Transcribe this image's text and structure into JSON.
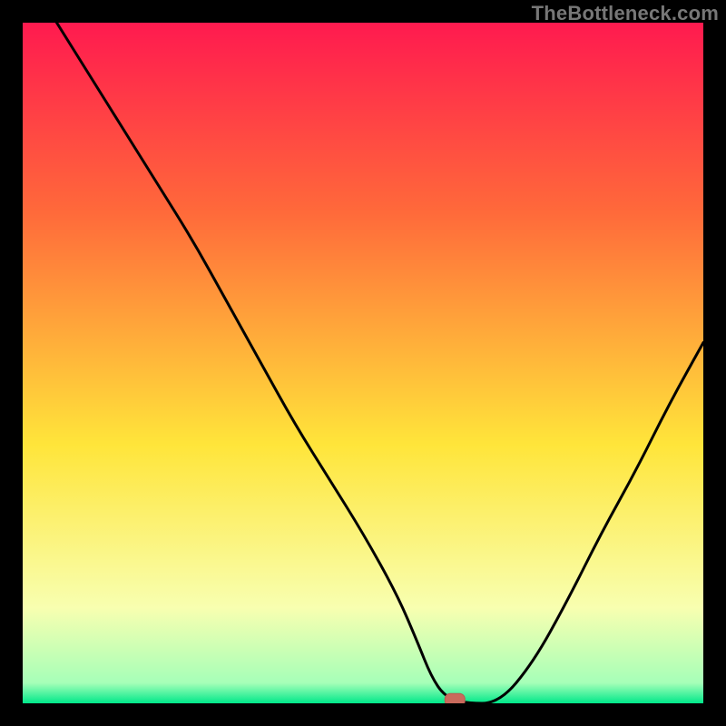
{
  "watermark": "TheBottleneck.com",
  "colors": {
    "frame": "#000000",
    "gradient_top": "#ff1a4f",
    "gradient_mid1": "#ff6a3a",
    "gradient_mid2": "#ffe53a",
    "gradient_pale": "#f8ffb0",
    "gradient_green": "#00e88a",
    "curve": "#000000",
    "marker_fill": "#c96a5c",
    "marker_stroke": "#b85a50"
  },
  "chart_data": {
    "type": "line",
    "title": "",
    "xlabel": "",
    "ylabel": "",
    "xlim": [
      0,
      100
    ],
    "ylim": [
      0,
      100
    ],
    "legend": false,
    "grid": false,
    "series": [
      {
        "name": "bottleneck-curve",
        "x": [
          5,
          10,
          15,
          20,
          25,
          30,
          35,
          40,
          45,
          50,
          55,
          58,
          60,
          62,
          65,
          70,
          75,
          80,
          85,
          90,
          95,
          100
        ],
        "y": [
          100,
          92,
          84,
          76,
          68,
          59,
          50,
          41,
          33,
          25,
          16,
          9,
          4,
          1,
          0,
          0,
          6,
          15,
          25,
          34,
          44,
          53
        ]
      }
    ],
    "annotations": [
      {
        "name": "optimal-marker",
        "x": 63.5,
        "y": 0.5,
        "shape": "rounded-rect"
      }
    ],
    "background_gradient_stops": [
      {
        "offset": 0.0,
        "color": "#ff1a4f"
      },
      {
        "offset": 0.28,
        "color": "#ff6a3a"
      },
      {
        "offset": 0.62,
        "color": "#ffe53a"
      },
      {
        "offset": 0.86,
        "color": "#f8ffb0"
      },
      {
        "offset": 0.97,
        "color": "#a6ffb8"
      },
      {
        "offset": 1.0,
        "color": "#00e88a"
      }
    ]
  }
}
